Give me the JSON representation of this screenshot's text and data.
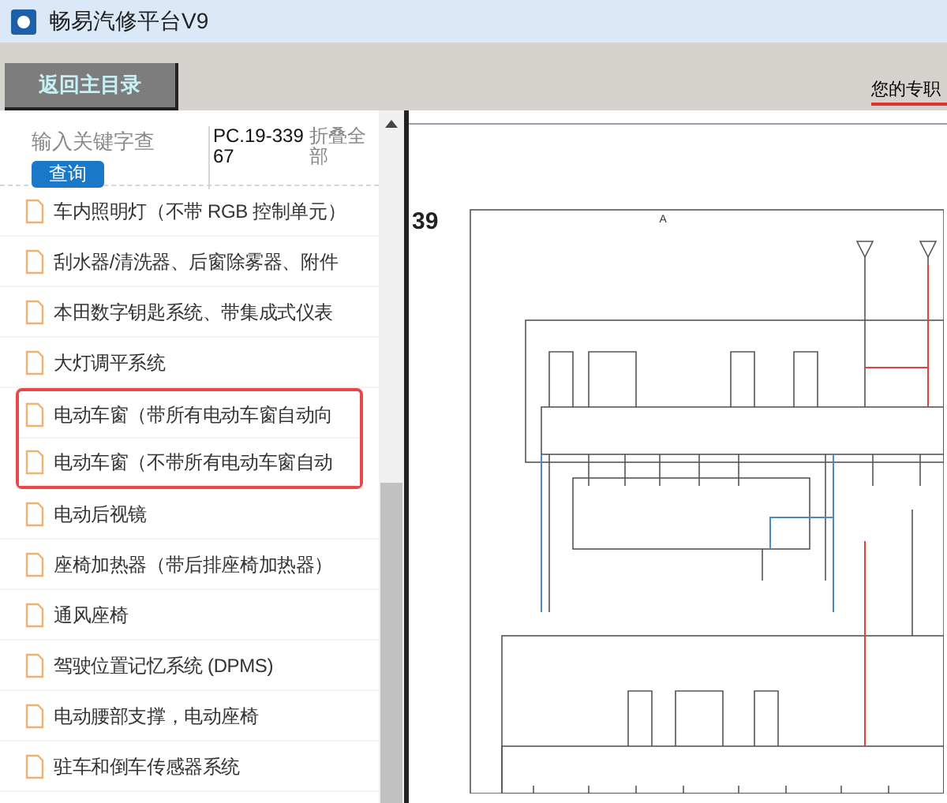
{
  "window": {
    "title": "畅易汽修平台V9"
  },
  "toolbar": {
    "back_button": "返回主目录",
    "notice": "您的专职"
  },
  "search": {
    "placeholder": "输入关键字查",
    "button": "查询",
    "code": "PC.19-33967",
    "collapse": "折叠全部"
  },
  "items": [
    {
      "label": "车内照明灯（不带 RGB 控制单元）",
      "annotated": false
    },
    {
      "label": "刮水器/清洗器、后窗除雾器、附件",
      "annotated": false
    },
    {
      "label": "本田数字钥匙系统、带集成式仪表",
      "annotated": false
    },
    {
      "label": "大灯调平系统",
      "annotated": false
    },
    {
      "label": "电动车窗（带所有电动车窗自动向",
      "annotated": true
    },
    {
      "label": "电动车窗（不带所有电动车窗自动",
      "annotated": true
    },
    {
      "label": "电动后视镜",
      "annotated": false
    },
    {
      "label": "座椅加热器（带后排座椅加热器）",
      "annotated": false
    },
    {
      "label": "通风座椅",
      "annotated": false
    },
    {
      "label": "驾驶位置记忆系统 (DPMS)",
      "annotated": false
    },
    {
      "label": "电动腰部支撑，电动座椅",
      "annotated": false
    },
    {
      "label": "驻车和倒车传感器系统",
      "annotated": false
    }
  ],
  "document": {
    "page_number": "39",
    "section": "A"
  }
}
